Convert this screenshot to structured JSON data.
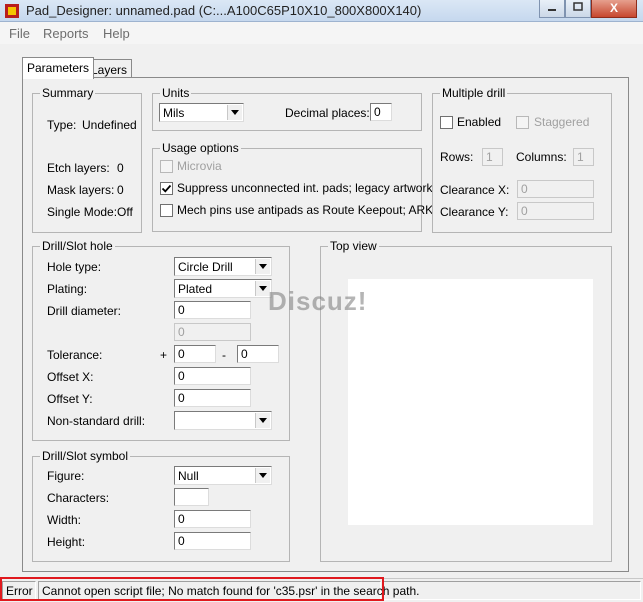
{
  "window": {
    "title": "Pad_Designer: unnamed.pad (C:...A100C65P10X10_800X800X140)",
    "close_glyph": "X"
  },
  "menu": [
    "File",
    "Reports",
    "Help"
  ],
  "tabs": [
    "Parameters",
    "Layers"
  ],
  "summary": {
    "title": "Summary",
    "type_label": "Type:",
    "type_value": "Undefined",
    "etch_label": "Etch layers:",
    "etch_value": "0",
    "mask_label": "Mask layers:",
    "mask_value": "0",
    "single_label": "Single Mode:",
    "single_value": "Off"
  },
  "units": {
    "title": "Units",
    "unit_value": "Mils",
    "decimal_label": "Decimal places:",
    "decimal_value": "0"
  },
  "usage": {
    "title": "Usage options",
    "options": [
      {
        "label": "Microvia",
        "checked": false,
        "disabled": true
      },
      {
        "label": "Suppress unconnected int. pads; legacy artwork",
        "checked": true,
        "disabled": false
      },
      {
        "label": "Mech pins use antipads as Route Keepout; ARK",
        "checked": false,
        "disabled": false
      }
    ]
  },
  "multiple_drill": {
    "title": "Multiple drill",
    "enabled_label": "Enabled",
    "staggered_label": "Staggered",
    "rows_label": "Rows:",
    "rows_value": "1",
    "columns_label": "Columns:",
    "columns_value": "1",
    "clearance_x_label": "Clearance X:",
    "clearance_x_value": "0",
    "clearance_y_label": "Clearance Y:",
    "clearance_y_value": "0"
  },
  "drill_hole": {
    "title": "Drill/Slot hole",
    "hole_type_label": "Hole type:",
    "hole_type_value": "Circle Drill",
    "plating_label": "Plating:",
    "plating_value": "Plated",
    "diameter_label": "Drill diameter:",
    "diameter_value": "0",
    "diameter2_value": "0",
    "tolerance_label": "Tolerance:",
    "tol_plus": "+",
    "tol_plus_value": "0",
    "tol_minus": "-",
    "tol_minus_value": "0",
    "offset_x_label": "Offset X:",
    "offset_x_value": "0",
    "offset_y_label": "Offset Y:",
    "offset_y_value": "0",
    "nonstd_label": "Non-standard drill:",
    "nonstd_value": ""
  },
  "drill_symbol": {
    "title": "Drill/Slot symbol",
    "figure_label": "Figure:",
    "figure_value": "Null",
    "characters_label": "Characters:",
    "characters_value": "",
    "width_label": "Width:",
    "width_value": "0",
    "height_label": "Height:",
    "height_value": "0"
  },
  "top_view": {
    "title": "Top view",
    "watermark": "Discuz!"
  },
  "status": {
    "level": "Error",
    "message": "Cannot open script file; No match found for 'c35.psr' in the search path.",
    "highlight_color": "#e0191e"
  }
}
